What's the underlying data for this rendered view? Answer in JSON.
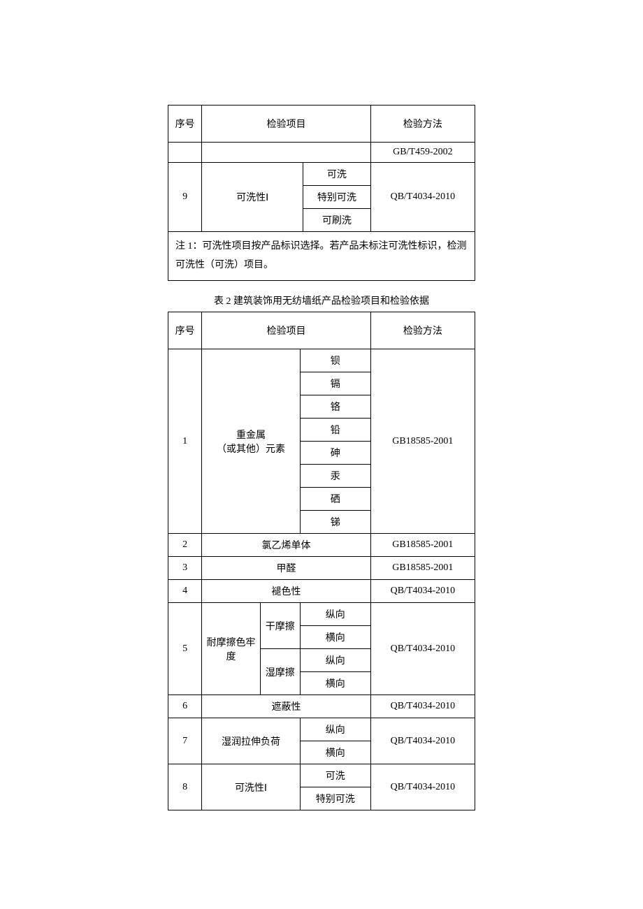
{
  "table1": {
    "headers": {
      "seq": "序号",
      "item": "检验项目",
      "method": "检验方法"
    },
    "blank_method": "GB/T459-2002",
    "row9": {
      "seq": "9",
      "name": "可洗性Ⅰ",
      "subs": [
        "可洗",
        "特别可洗",
        "可刷洗"
      ],
      "method": "QB/T4034-2010"
    },
    "note": "注 1：可洗性项目按产品标识选择。若产品未标注可洗性标识，检测可洗性（可洗）项目。"
  },
  "table2": {
    "caption": "表 2 建筑装饰用无纺墙纸产品检验项目和检验依据",
    "headers": {
      "seq": "序号",
      "item": "检验项目",
      "method": "检验方法"
    },
    "row1": {
      "seq": "1",
      "name_line1": "重金属",
      "name_line2": "（或其他）元素",
      "subs": [
        "钡",
        "镉",
        "铬",
        "铅",
        "砷",
        "汞",
        "硒",
        "锑"
      ],
      "method": "GB18585-2001"
    },
    "row2": {
      "seq": "2",
      "name": "氯乙烯单体",
      "method": "GB18585-2001"
    },
    "row3": {
      "seq": "3",
      "name": "甲醛",
      "method": "GB18585-2001"
    },
    "row4": {
      "seq": "4",
      "name": "褪色性",
      "method": "QB/T4034-2010"
    },
    "row5": {
      "seq": "5",
      "name": "耐摩擦色牢度",
      "group1": "干摩擦",
      "group2": "湿摩擦",
      "subs": [
        "纵向",
        "横向",
        "纵向",
        "横向"
      ],
      "method": "QB/T4034-2010"
    },
    "row6": {
      "seq": "6",
      "name": "遮蔽性",
      "method": "QB/T4034-2010"
    },
    "row7": {
      "seq": "7",
      "name": "湿润拉伸负荷",
      "subs": [
        "纵向",
        "横向"
      ],
      "method": "QB/T4034-2010"
    },
    "row8": {
      "seq": "8",
      "name": "可洗性Ⅰ",
      "subs": [
        "可洗",
        "特别可洗"
      ],
      "method": "QB/T4034-2010"
    }
  }
}
